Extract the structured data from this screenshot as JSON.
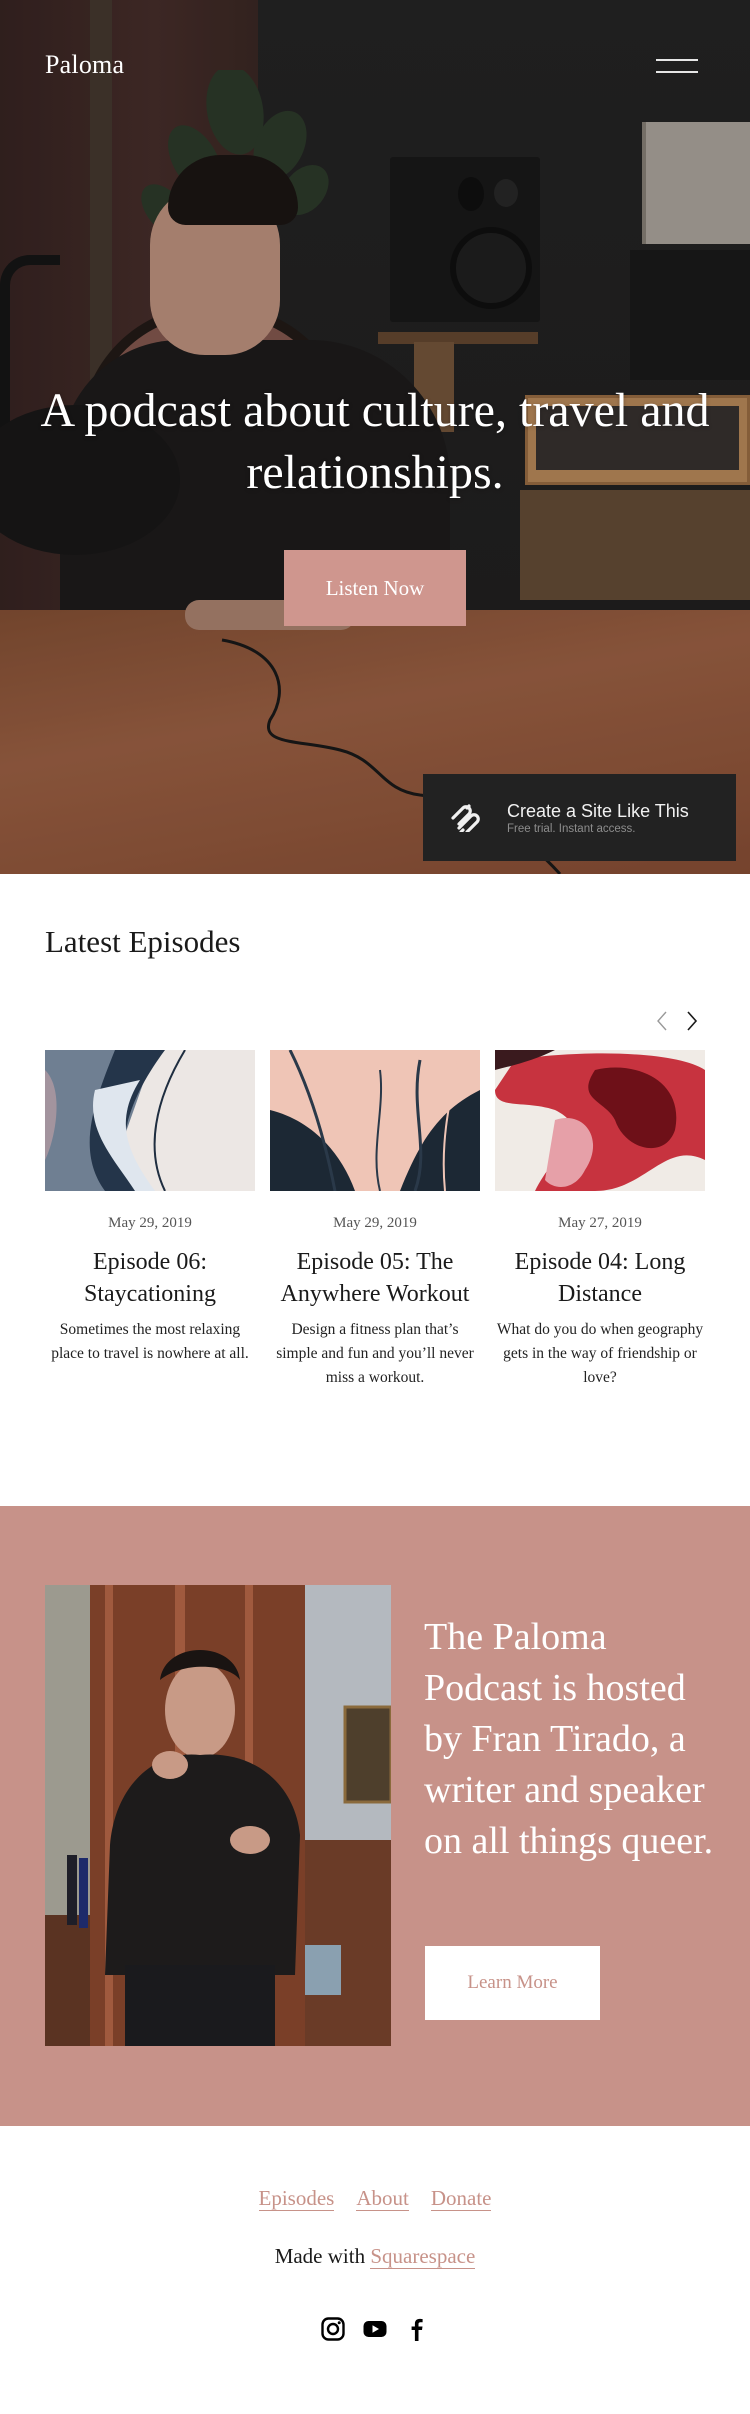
{
  "header": {
    "site_title": "Paloma",
    "menu_icon": "hamburger-menu-icon"
  },
  "hero": {
    "headline": "A podcast about culture, travel and relationships.",
    "cta_label": "Listen Now"
  },
  "badge": {
    "icon": "squarespace-logo-icon",
    "title": "Create a Site Like This",
    "subtitle": "Free trial. Instant access."
  },
  "episodes": {
    "title": "Latest Episodes",
    "prev_icon": "chevron-left-icon",
    "next_icon": "chevron-right-icon",
    "items": [
      {
        "date": "May 29, 2019",
        "title": "Episode 06: Staycationing",
        "description": "Sometimes the most relaxing place to travel is nowhere at all."
      },
      {
        "date": "May 29, 2019",
        "title": "Episode 05: The Anywhere Workout",
        "description": "Design a fitness plan that’s simple and fun and you’ll never miss a workout."
      },
      {
        "date": "May 27, 2019",
        "title": "Episode 04: Long Distance",
        "description": "What do you do when geography gets in the way of friendship or love?"
      }
    ]
  },
  "about": {
    "text": "The Paloma Podcast is hosted by Fran Tirado, a writer and speaker on all things queer.",
    "cta_label": "Learn More"
  },
  "footer": {
    "nav": [
      "Episodes",
      "About",
      "Donate"
    ],
    "made_with_prefix": "Made with ",
    "made_with_link": "Squarespace",
    "social": [
      "instagram-icon",
      "youtube-icon",
      "facebook-icon"
    ]
  },
  "colors": {
    "accent": "#c79289",
    "button_pink": "#cf968e",
    "badge_bg": "#222222"
  }
}
